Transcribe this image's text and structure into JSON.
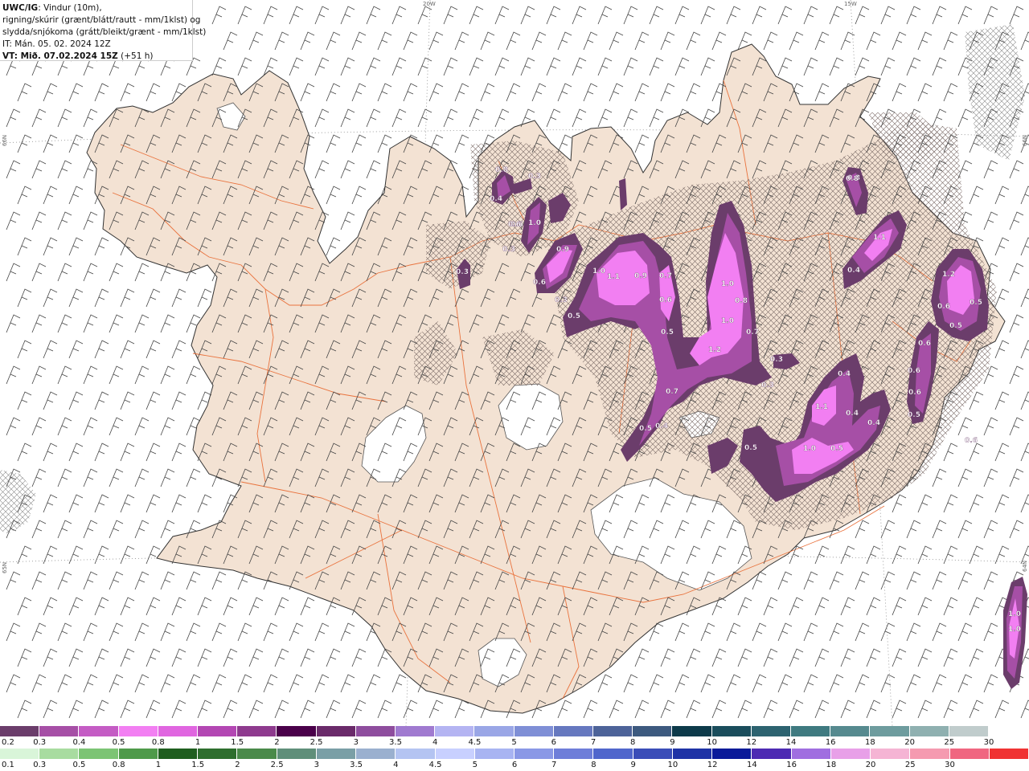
{
  "title": {
    "product": "UWC/IG",
    "line1_rest": ": Vindur (10m),",
    "line2": "rigning/skúrir (grænt/blátt/rautt - mm/1klst) og",
    "line3": "slydda/snjókoma (grátt/bleikt/grænt - mm/1klst)",
    "line4": "IT: Mán. 05. 02. 2024 12Z",
    "line5_bold": "VT: Mið. 07.02.2024 15Z",
    "line5_rest": " (+51 h)"
  },
  "graticule_labels": {
    "lon_20w": "20W",
    "lon_15w": "15W",
    "lat_66n": "66N",
    "lat_65n": "65N",
    "lat_64n_right": "64N",
    "lat_66n_right": "66N"
  },
  "precip_labels": [
    {
      "text": "0.8"
    },
    {
      "text": "0.4"
    },
    {
      "text": "0.3"
    },
    {
      "text": "0.5"
    },
    {
      "text": "1.0"
    },
    {
      "text": "0.3"
    },
    {
      "text": "0.9"
    },
    {
      "text": "0.6"
    },
    {
      "text": "0.6"
    },
    {
      "text": "0.3"
    },
    {
      "text": "0.5"
    },
    {
      "text": "0.3"
    },
    {
      "text": "1.0"
    },
    {
      "text": "1.1"
    },
    {
      "text": "0.9"
    },
    {
      "text": "0.7"
    },
    {
      "text": "0.6"
    },
    {
      "text": "0.5"
    },
    {
      "text": "0.4"
    },
    {
      "text": "1.0"
    },
    {
      "text": "0.8"
    },
    {
      "text": "1.0"
    },
    {
      "text": "0.7"
    },
    {
      "text": "1.2"
    },
    {
      "text": "0.7"
    },
    {
      "text": "0.3"
    },
    {
      "text": "0.3"
    },
    {
      "text": "0.5"
    },
    {
      "text": "0.4"
    },
    {
      "text": "0.6"
    },
    {
      "text": "0.5"
    },
    {
      "text": "0.4"
    },
    {
      "text": "1.1"
    },
    {
      "text": "0.4"
    },
    {
      "text": "0.5"
    },
    {
      "text": "1.0"
    },
    {
      "text": "0.8"
    },
    {
      "text": "0.8"
    },
    {
      "text": "1.1"
    },
    {
      "text": "0.4"
    },
    {
      "text": "1.2"
    },
    {
      "text": "0.6"
    },
    {
      "text": "0.5"
    },
    {
      "text": "0.5"
    },
    {
      "text": "0.6"
    },
    {
      "text": "0.6"
    },
    {
      "text": "0.6"
    },
    {
      "text": "0.5"
    },
    {
      "text": "1.0"
    },
    {
      "text": "1.0"
    }
  ],
  "legend_snow": {
    "values": [
      "0.2",
      "0.3",
      "0.4",
      "0.5",
      "0.8",
      "1",
      "1.5",
      "2",
      "2.5",
      "3",
      "3.5",
      "4",
      "4.5",
      "5",
      "6",
      "7",
      "8",
      "9",
      "10",
      "12",
      "14",
      "16",
      "18",
      "20",
      "25",
      "30"
    ],
    "colors": [
      "#6b3d6b",
      "#a64fa6",
      "#c45cc4",
      "#f27ff2",
      "#e066e0",
      "#b347b3",
      "#8e3a8e",
      "#4a004a",
      "#6a2a6a",
      "#8e4d9e",
      "#a07ad0",
      "#b4b4f2",
      "#9aa6e6",
      "#7f8fd6",
      "#6678bf",
      "#4d6399",
      "#3d5a7f",
      "#0d3a4a",
      "#1a4d5c",
      "#2d6370",
      "#3f7a80",
      "#568a8f",
      "#6e9c9e",
      "#8fb0b0",
      "#c0cccc"
    ]
  },
  "legend_rain": {
    "values": [
      "0.1",
      "0.3",
      "0.5",
      "0.8",
      "1",
      "1.5",
      "2",
      "2.5",
      "3",
      "3.5",
      "4",
      "4.5",
      "5",
      "6",
      "7",
      "8",
      "9",
      "10",
      "12",
      "14",
      "16",
      "18",
      "20",
      "25",
      "30"
    ],
    "colors": [
      "#d9f5d9",
      "#a8dca0",
      "#7cc474",
      "#4e9a4a",
      "#1f5e1f",
      "#2e6e2e",
      "#4a8a4a",
      "#5f8f7a",
      "#7a9fa6",
      "#9ab0cf",
      "#b4c4f2",
      "#c8d0ff",
      "#a8b4f2",
      "#8a98e6",
      "#6e7ed9",
      "#5066cc",
      "#3a4db8",
      "#1f33a6",
      "#0a1a99",
      "#4d2ab3",
      "#a06ee0",
      "#e8a0e8",
      "#f5b4d4",
      "#f59ab0",
      "#f06680",
      "#f03333"
    ]
  }
}
